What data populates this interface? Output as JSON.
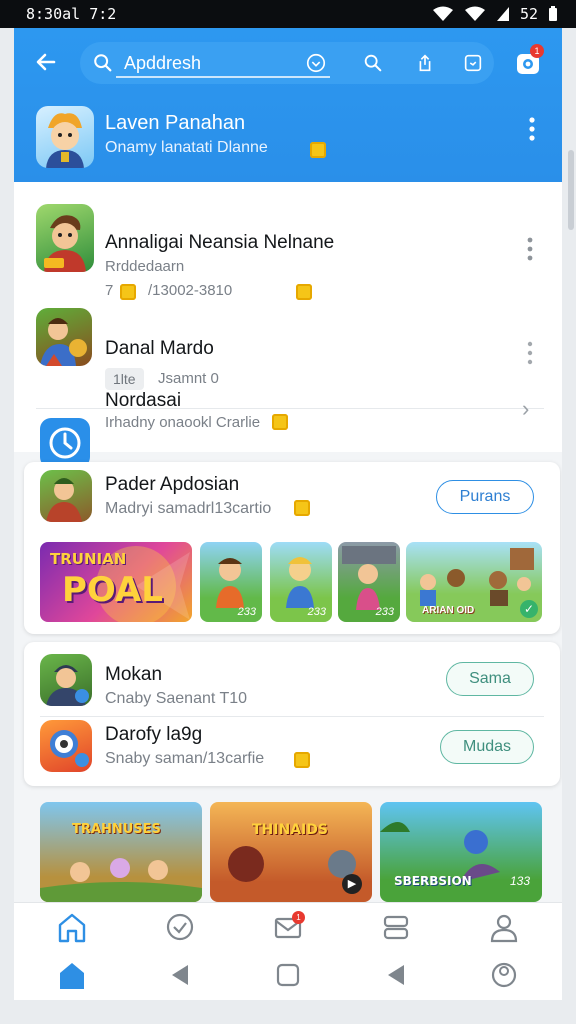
{
  "status_bar": {
    "time": "8:30al 7:2",
    "battery": "52"
  },
  "header": {
    "search_text": "Apddresh",
    "featured": {
      "title": "Laven Panahan",
      "subtitle": "Onamy lanatati Dlanne"
    }
  },
  "list": [
    {
      "title": "Annaligai Neansia Nelnane",
      "line1": "Rrddedaarn",
      "line2_a": "7",
      "line2_b": "/13002-3810"
    },
    {
      "title": "Danal Mardo",
      "chip": "1lte",
      "meta": "Jsamnt 0"
    },
    {
      "title": "Nordasai",
      "subtitle": "Irhadny  onaookl Crarlie"
    }
  ],
  "promo_card": {
    "title": "Pader Apdosian",
    "subtitle": "Madryi samadrl13cartio",
    "button": "Purans",
    "banner_title": "TRUNIAN",
    "banner_word": "POAL",
    "shot_labels": [
      "233",
      "233",
      "233",
      "ARIAN OID"
    ]
  },
  "small_card": [
    {
      "title": "Mokan",
      "subtitle": "Cnaby  Saenant T10",
      "button": "Sama"
    },
    {
      "title": "Darofy la9g",
      "subtitle": "Snaby  saman/13carfie",
      "button": "Mudas"
    }
  ],
  "bottom_shots": [
    {
      "caption": "TRAHNUSES"
    },
    {
      "caption": "THINAIDS"
    },
    {
      "caption": "SBERBSION",
      "num": "133"
    }
  ],
  "colors": {
    "primary": "#2d98f0",
    "accent_green": "#5fb7a2",
    "badge": "#e8392f"
  }
}
